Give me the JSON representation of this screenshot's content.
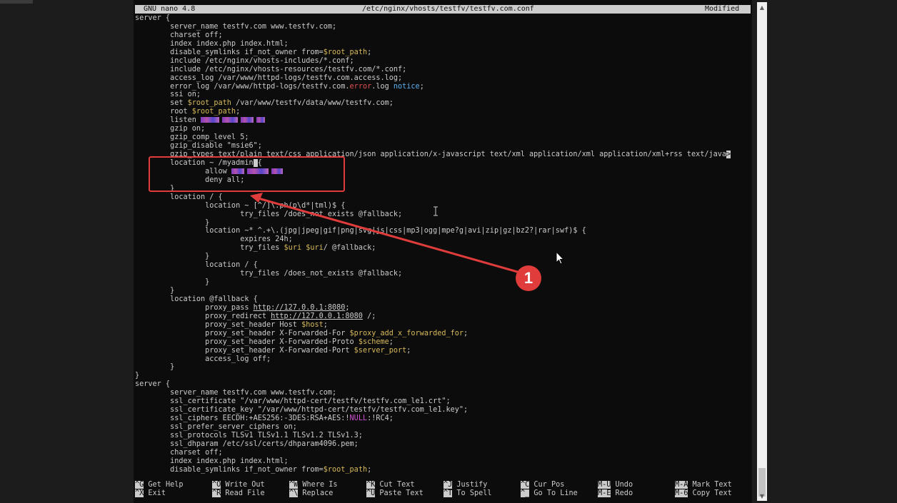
{
  "titlebar": {
    "app": "GNU nano 4.8",
    "file": "/etc/nginx/vhosts/testfv/testfv.com.conf",
    "status": "Modified"
  },
  "colors": {
    "normal": "#cccccc",
    "var": "#d7b95b",
    "notice": "#5ab0f0",
    "error": "#e05050",
    "null": "#d050d0",
    "annotation": "#e03c3c"
  },
  "lines": [
    [
      {
        "t": "server {"
      }
    ],
    [
      {
        "t": "        server_name testfv.com www.testfv.com;"
      }
    ],
    [
      {
        "t": "        charset off;"
      }
    ],
    [
      {
        "t": "        index index.php index.html;"
      }
    ],
    [
      {
        "t": "        disable_symlinks if_not_owner from="
      },
      {
        "t": "$root_path",
        "c": "var"
      },
      {
        "t": ";"
      }
    ],
    [
      {
        "t": "        include /etc/nginx/vhosts-includes/*.conf;"
      }
    ],
    [
      {
        "t": "        include /etc/nginx/vhosts-resources/testfv.com/*.conf;"
      }
    ],
    [
      {
        "t": "        access_log /var/www/httpd-logs/testfv.com.access.log;"
      }
    ],
    [
      {
        "t": "        error_log /var/www/httpd-logs/testfv.com."
      },
      {
        "t": "error",
        "c": "error"
      },
      {
        "t": ".log "
      },
      {
        "t": "notice",
        "c": "notice"
      },
      {
        "t": ";"
      }
    ],
    [
      {
        "t": "        ssi on;"
      }
    ],
    [
      {
        "t": "        set "
      },
      {
        "t": "$root_path",
        "c": "var"
      },
      {
        "t": " /var/www/testfv/data/www/testfv.com;"
      }
    ],
    [
      {
        "t": "        root "
      },
      {
        "t": "$root_path",
        "c": "var"
      },
      {
        "t": ";"
      }
    ],
    [
      {
        "t": "        listen "
      },
      {
        "redacted": [
          26,
          22,
          18,
          12
        ]
      }
    ],
    [
      {
        "t": "        gzip on;"
      }
    ],
    [
      {
        "t": "        gzip_comp_level 5;"
      }
    ],
    [
      {
        "t": "        gzip_disable \"msie6\";"
      }
    ],
    [
      {
        "t": "        gzip_types text/plain text/css application/json application/x-javascript text/xml application/xml application/xml+rss text/java"
      },
      {
        "t": ">",
        "cursor": true
      }
    ],
    [
      {
        "t": "        location ~ /myadmin"
      },
      {
        "t": " ",
        "cursor": true
      },
      {
        "t": "{"
      }
    ],
    [
      {
        "t": "                allow "
      },
      {
        "redacted": [
          18,
          30,
          16
        ]
      }
    ],
    [
      {
        "t": "                deny all;"
      }
    ],
    [
      {
        "t": "        }"
      }
    ],
    [
      {
        "t": "        location / {"
      }
    ],
    [
      {
        "t": "                location ~ [^/]\\.ph(p\\d*|tml)$ {"
      }
    ],
    [
      {
        "t": "                        try_files /does_not_exists @fallback;"
      }
    ],
    [
      {
        "t": "                }"
      }
    ],
    [
      {
        "t": "                location ~* ^.+\\.(jpg|jpeg|gif|png|svg|js|css|mp3|ogg|mpe?g|avi|zip|gz|bz2?|rar|swf)$ {"
      }
    ],
    [
      {
        "t": "                        expires 24h;"
      }
    ],
    [
      {
        "t": "                        try_files "
      },
      {
        "t": "$uri",
        "c": "var"
      },
      {
        "t": " "
      },
      {
        "t": "$uri",
        "c": "var"
      },
      {
        "t": "/ @fallback;"
      }
    ],
    [
      {
        "t": "                }"
      }
    ],
    [
      {
        "t": "                location / {"
      }
    ],
    [
      {
        "t": "                        try_files /does_not_exists @fallback;"
      }
    ],
    [
      {
        "t": "                }"
      }
    ],
    [
      {
        "t": "        }"
      }
    ],
    [
      {
        "t": "        location @fallback {"
      }
    ],
    [
      {
        "t": "                proxy_pass "
      },
      {
        "t": "http://127.0.0.1:8080",
        "u": true
      },
      {
        "t": ";"
      }
    ],
    [
      {
        "t": "                proxy_redirect "
      },
      {
        "t": "http://127.0.0.1:8080",
        "u": true
      },
      {
        "t": " /;"
      }
    ],
    [
      {
        "t": "                proxy_set_header Host "
      },
      {
        "t": "$host",
        "c": "var"
      },
      {
        "t": ";"
      }
    ],
    [
      {
        "t": "                proxy_set_header X-Forwarded-For "
      },
      {
        "t": "$proxy_add_x_forwarded_for",
        "c": "var"
      },
      {
        "t": ";"
      }
    ],
    [
      {
        "t": "                proxy_set_header X-Forwarded-Proto "
      },
      {
        "t": "$scheme",
        "c": "var"
      },
      {
        "t": ";"
      }
    ],
    [
      {
        "t": "                proxy_set_header X-Forwarded-Port "
      },
      {
        "t": "$server_port",
        "c": "var"
      },
      {
        "t": ";"
      }
    ],
    [
      {
        "t": "                access_log off;"
      }
    ],
    [
      {
        "t": "        }"
      }
    ],
    [
      {
        "t": "}"
      }
    ],
    [
      {
        "t": "server {"
      }
    ],
    [
      {
        "t": "        server_name testfv.com www.testfv.com;"
      }
    ],
    [
      {
        "t": "        ssl_certificate \"/var/www/httpd-cert/testfv/testfv.com_le1.crt\";"
      }
    ],
    [
      {
        "t": "        ssl_certificate_key \"/var/www/httpd-cert/testfv/testfv.com_le1.key\";"
      }
    ],
    [
      {
        "t": "        ssl_ciphers EECDH:+AES256:-3DES:RSA+AES:!"
      },
      {
        "t": "NULL",
        "c": "null"
      },
      {
        "t": ":!RC4;"
      }
    ],
    [
      {
        "t": "        ssl_prefer_server_ciphers on;"
      }
    ],
    [
      {
        "t": "        ssl_protocols TLSv1 TLSv1.1 TLSv1.2 TLSv1.3;"
      }
    ],
    [
      {
        "t": "        ssl_dhparam /etc/ssl/certs/dhparam4096.pem;"
      }
    ],
    [
      {
        "t": "        charset off;"
      }
    ],
    [
      {
        "t": "        index index.php index.html;"
      }
    ],
    [
      {
        "t": "        disable_symlinks if_not_owner from="
      },
      {
        "t": "$root_path",
        "c": "var"
      },
      {
        "t": ";"
      }
    ]
  ],
  "shortcuts": [
    {
      "top": {
        "key": "^G",
        "label": "Get Help"
      },
      "bottom": {
        "key": "^X",
        "label": "Exit"
      }
    },
    {
      "top": {
        "key": "^O",
        "label": "Write Out"
      },
      "bottom": {
        "key": "^R",
        "label": "Read File"
      }
    },
    {
      "top": {
        "key": "^W",
        "label": "Where Is"
      },
      "bottom": {
        "key": "^\\",
        "label": "Replace"
      }
    },
    {
      "top": {
        "key": "^K",
        "label": "Cut Text"
      },
      "bottom": {
        "key": "^U",
        "label": "Paste Text"
      }
    },
    {
      "top": {
        "key": "^J",
        "label": "Justify"
      },
      "bottom": {
        "key": "^T",
        "label": "To Spell"
      }
    },
    {
      "top": {
        "key": "^C",
        "label": "Cur Pos"
      },
      "bottom": {
        "key": "^_",
        "label": "Go To Line"
      }
    },
    {
      "top": {
        "key": "M-U",
        "label": "Undo"
      },
      "bottom": {
        "key": "M-E",
        "label": "Redo"
      }
    },
    {
      "top": {
        "key": "M-A",
        "label": "Mark Text"
      },
      "bottom": {
        "key": "M-6",
        "label": "Copy Text"
      }
    }
  ],
  "annotation": {
    "badge_number": "1"
  },
  "scrollbar": {
    "up_arrow": "▲",
    "down_arrow": "▼"
  },
  "icons": {
    "mouse": "mouse-pointer-icon",
    "ibeam": "text-cursor-icon"
  }
}
